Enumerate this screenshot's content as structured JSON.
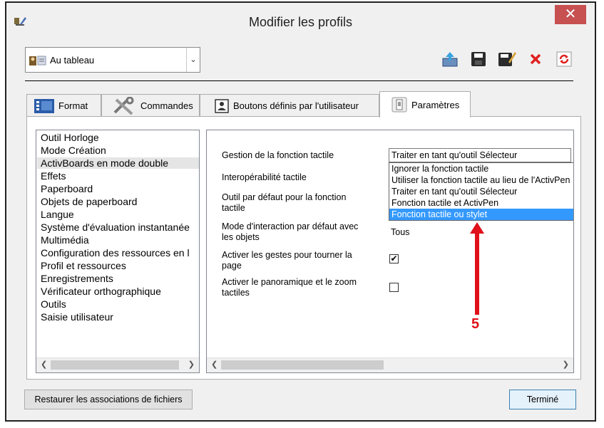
{
  "window": {
    "title": "Modifier les profils",
    "close": "✕"
  },
  "profile": {
    "selected": "Au tableau",
    "icon": "profile-board-icon"
  },
  "toolbar": {
    "icons": [
      "export-icon",
      "save-icon",
      "save-as-icon",
      "delete-icon",
      "refresh-icon"
    ]
  },
  "tabs": [
    {
      "label": "Format",
      "icon": "format-icon"
    },
    {
      "label": "Commandes",
      "icon": "tools-icon"
    },
    {
      "label": "Boutons définis par l'utilisateur",
      "icon": "user-buttons-icon"
    },
    {
      "label": "Paramètres",
      "icon": "settings-icon",
      "active": true
    }
  ],
  "left_list": [
    "Outil Horloge",
    "Mode Création",
    "ActivBoards en mode double",
    "Effets",
    "Paperboard",
    "Objets de paperboard",
    "Langue",
    "Système d'évaluation instantanée",
    "Multimédia",
    "Configuration des ressources en l",
    "Profil et ressources",
    "Enregistrements",
    "Vérificateur orthographique",
    "Outils",
    "Saisie utilisateur"
  ],
  "left_list_selected": 2,
  "settings": {
    "touch_mgmt_label": "Gestion de la fonction tactile",
    "touch_mgmt_value": "Traiter en tant qu'outil Sélecteur",
    "touch_interop_label": "Interopérabilité tactile",
    "default_tool_label": "Outil par défaut pour la fonction tactile",
    "interaction_mode_label": "Mode d'interaction par défaut avec les objets",
    "interaction_mode_value": "Tous",
    "rotate_gestures_label": "Activer les gestes pour tourner la page",
    "rotate_gestures_checked": true,
    "pan_zoom_label": "Activer le panoramique et le zoom tactiles",
    "pan_zoom_checked": false,
    "dropdown_options": [
      "Ignorer la fonction tactile",
      "Utiliser la fonction tactile au lieu de l'ActivPen",
      "Traiter en tant qu'outil Sélecteur",
      "Fonction tactile et ActivPen",
      "Fonction tactile ou stylet"
    ],
    "dropdown_highlight": 4
  },
  "annotation": {
    "number": "5",
    "color": "#e0101a"
  },
  "buttons": {
    "restore": "Restaurer les associations de fichiers",
    "done": "Terminé"
  },
  "colors": {
    "selection": "#3399ff",
    "close": "#c75050",
    "done_border": "#3c7fb1"
  }
}
